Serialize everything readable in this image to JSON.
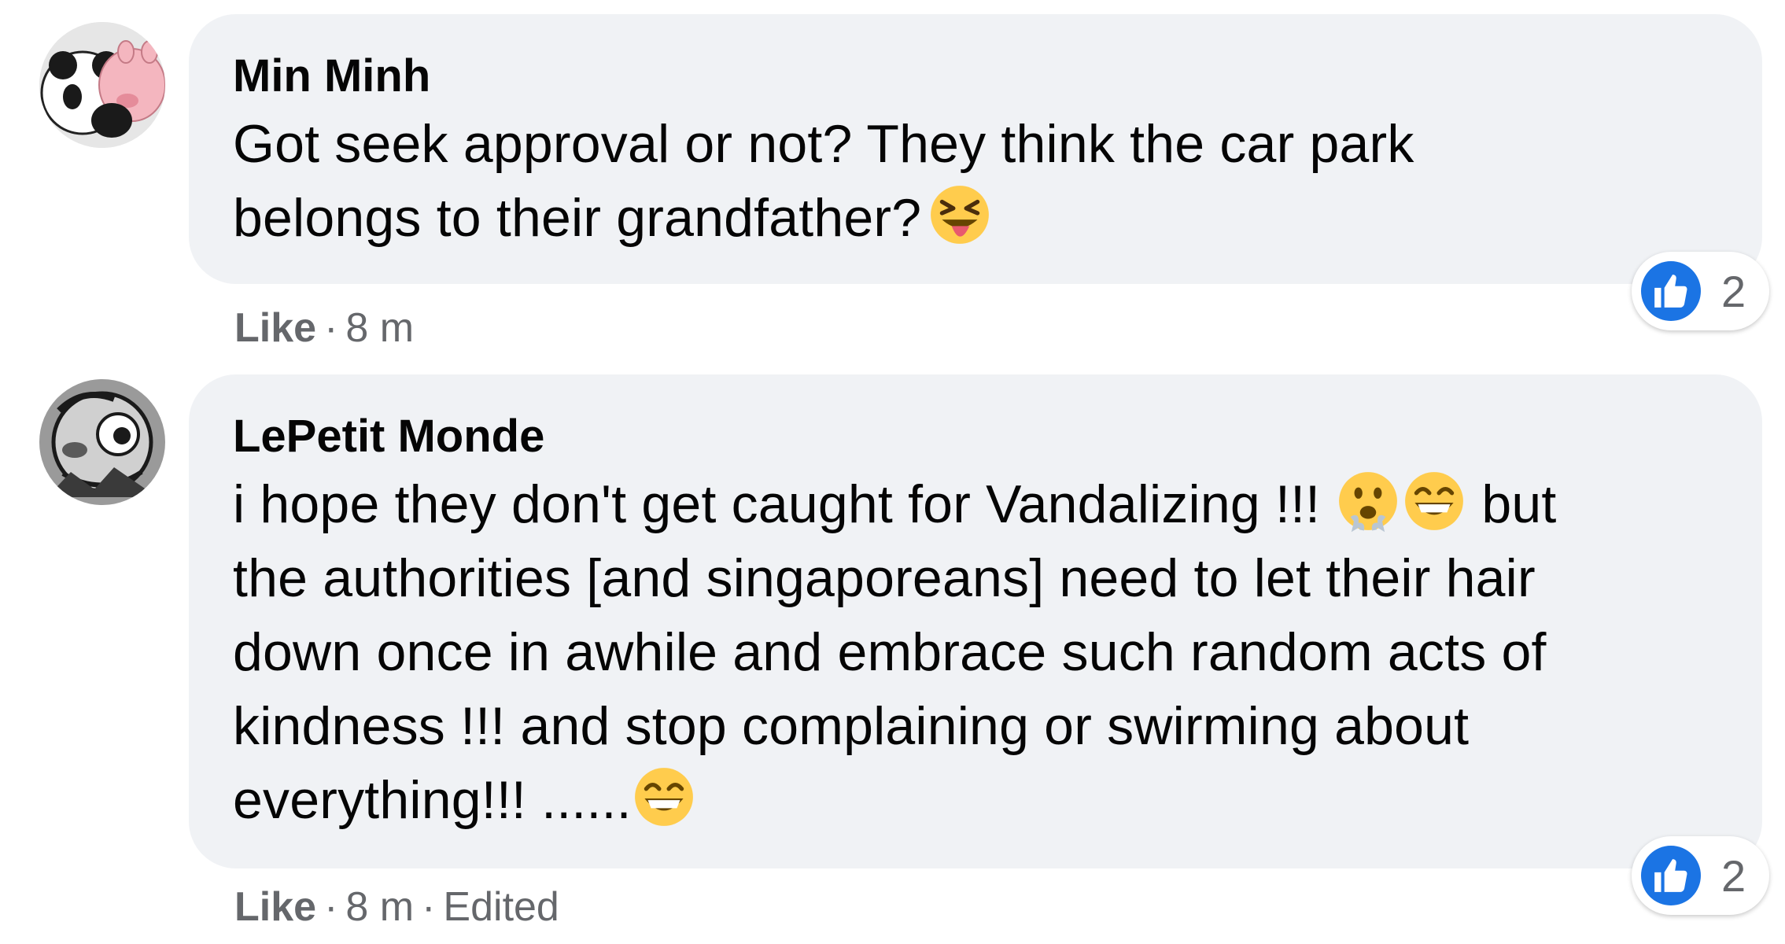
{
  "comments": [
    {
      "author": "Min Minh",
      "lines": [
        "Got seek approval or not? They think the car park",
        "belongs to their grandfather?"
      ],
      "line2_emoji": "squinting-tongue-emoji",
      "like_label": "Like",
      "time": "8 m",
      "reaction_count": "2",
      "avatar_icon": "panda-pig-avatar-icon"
    },
    {
      "author": "LePetit Monde",
      "line1": "i hope they don't get caught for Vandalizing !!!",
      "line1_tail": "but",
      "line1_emojis": [
        "face-with-steam-emoji",
        "grinning-emoji"
      ],
      "lines": [
        "the authorities [and singaporeans] need to let their hair",
        "down once in awhile and embrace such random acts of",
        "kindness !!! and stop complaining or swirming about"
      ],
      "last_line": "everything!!! ......",
      "last_line_emoji": "grinning-emoji",
      "like_label": "Like",
      "time": "8 m",
      "edited": "Edited",
      "reaction_count": "2",
      "avatar_icon": "cartoon-avatar-icon"
    }
  ],
  "colors": {
    "bubble_bg": "#f0f2f5",
    "meta_text": "#65676b",
    "like_blue": "#1b74e4"
  }
}
